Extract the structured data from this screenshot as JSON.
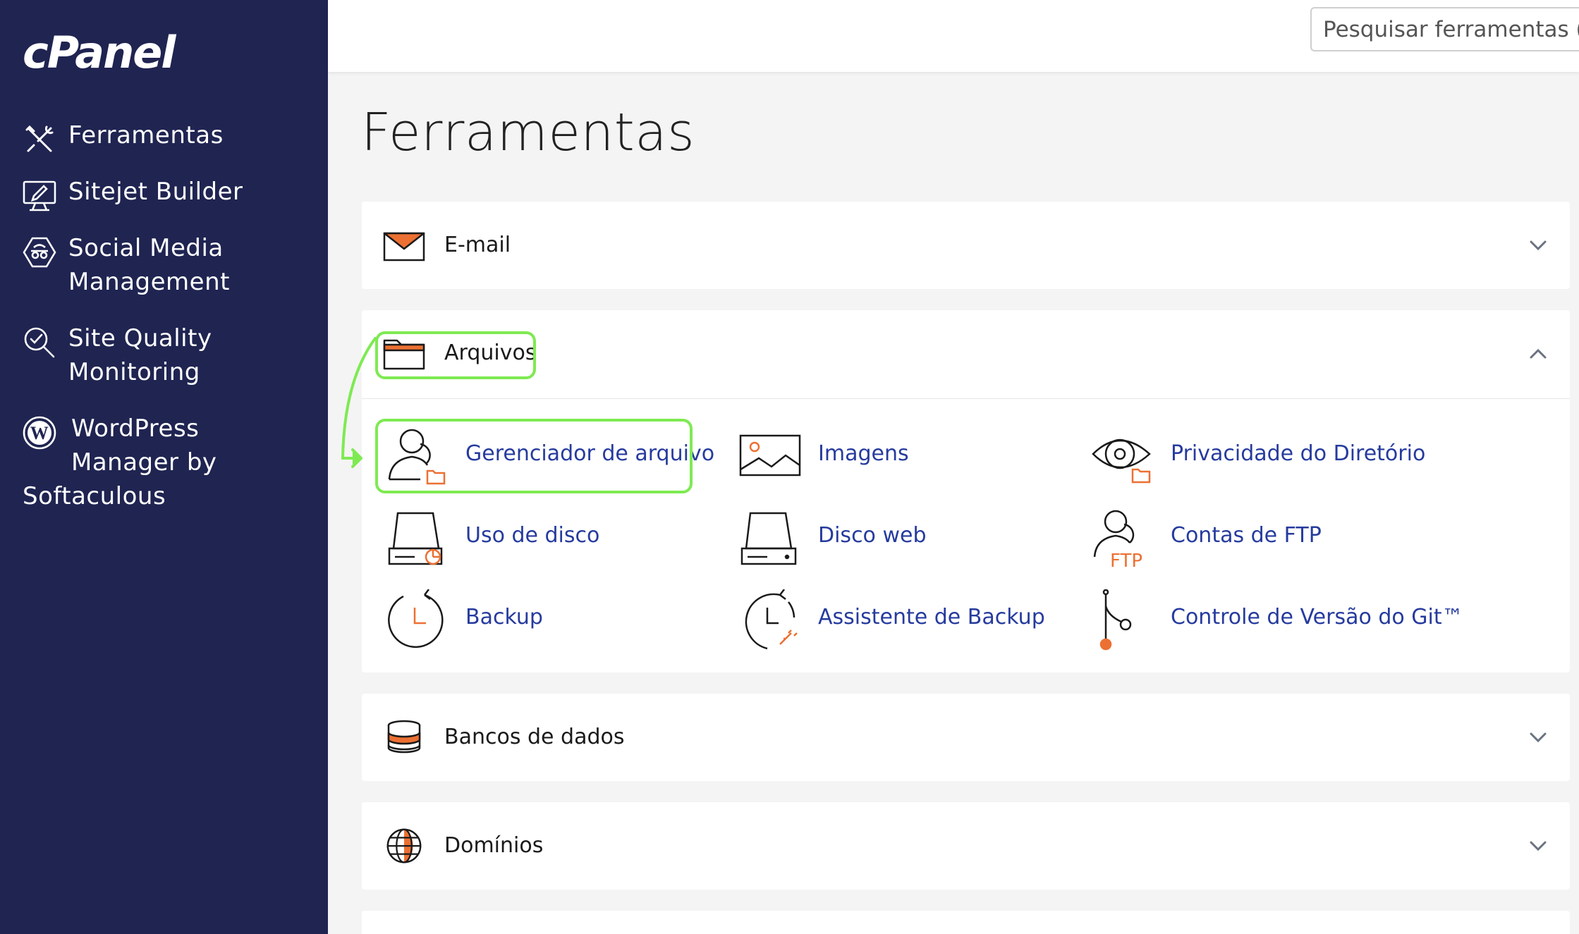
{
  "app": {
    "logo": "cPanel"
  },
  "sidebar": {
    "items": [
      {
        "lines": [
          "Ferramentas"
        ],
        "icon": "tools-icon"
      },
      {
        "lines": [
          "Sitejet Builder"
        ],
        "icon": "monitor-pen-icon"
      },
      {
        "lines": [
          "Social Media",
          "Management"
        ],
        "icon": "social-media-icon"
      },
      {
        "lines": [
          "Site Quality",
          "Monitoring"
        ],
        "icon": "magnifier-check-icon"
      },
      {
        "lines": [
          "WordPress",
          "Manager by",
          "Softaculous"
        ],
        "icon": "wordpress-icon"
      }
    ]
  },
  "search": {
    "placeholder": "Pesquisar ferramentas (/"
  },
  "main": {
    "title": "Ferramentas",
    "sections": [
      {
        "title": "E-mail",
        "icon": "envelope-icon",
        "expanded": false
      },
      {
        "title": "Arquivos",
        "icon": "folder-icon",
        "expanded": true,
        "tools": [
          {
            "label": "Gerenciador de arquivo",
            "icon": "user-folder-icon"
          },
          {
            "label": "Imagens",
            "icon": "image-icon"
          },
          {
            "label": "Privacidade do Diretório",
            "icon": "eye-folder-icon"
          },
          {
            "label": "Uso de disco",
            "icon": "disk-chart-icon"
          },
          {
            "label": "Disco web",
            "icon": "disk-icon"
          },
          {
            "label": "Contas de FTP",
            "icon": "user-ftp-icon",
            "icon_text": "FTP"
          },
          {
            "label": "Backup",
            "icon": "clock-icon"
          },
          {
            "label": "Assistente de Backup",
            "icon": "clock-wand-icon"
          },
          {
            "label": "Controle de Versão do Git™",
            "icon": "git-branch-icon"
          }
        ]
      },
      {
        "title": "Bancos de dados",
        "icon": "database-icon",
        "expanded": false
      },
      {
        "title": "Domínios",
        "icon": "globe-icon",
        "expanded": false
      }
    ]
  },
  "colors": {
    "sidebar": "#1f2451",
    "accent_orange": "#ec7032",
    "link_blue": "#263b9e",
    "highlight_green": "#7eea52"
  }
}
